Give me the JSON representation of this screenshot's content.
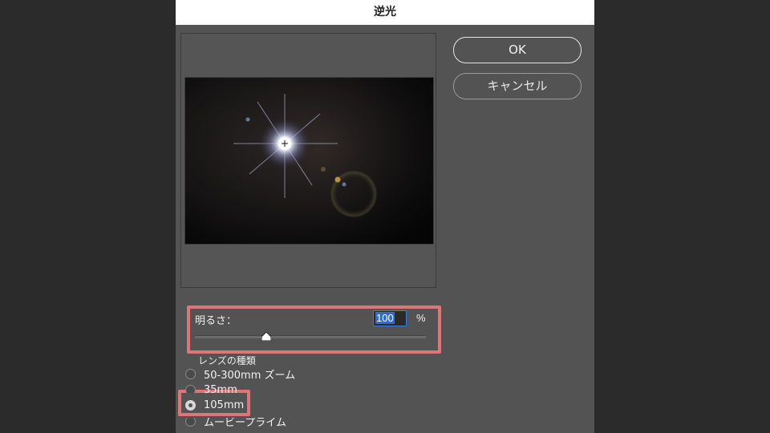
{
  "dialog": {
    "title": "逆光",
    "ok_label": "OK",
    "cancel_label": "キャンセル"
  },
  "brightness": {
    "label": "明るさ：",
    "value": "100",
    "unit": "%",
    "slider_level_percent": 100,
    "slider_min_percent": 10,
    "slider_max_percent": 300
  },
  "lens": {
    "heading": "レンズの種類",
    "options": [
      {
        "label": "50-300mm ズーム",
        "checked": false
      },
      {
        "label": "35mm",
        "checked": false
      },
      {
        "label": "105mm",
        "checked": true
      },
      {
        "label": "ムービープライム",
        "checked": false
      }
    ]
  },
  "colors": {
    "dialog_bg": "#535353",
    "highlight": "#e07579",
    "input_focus": "#3f7bd6"
  }
}
